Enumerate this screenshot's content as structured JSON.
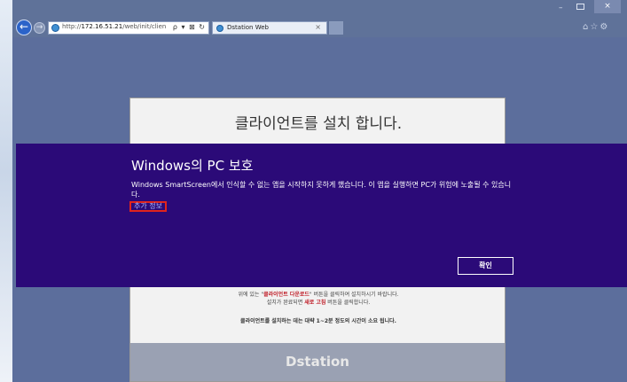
{
  "browser": {
    "url_prefix": "http://",
    "url_host": "172.16.51.21",
    "url_path": "/web/init/clien",
    "address_icons": "ρ ▾ ⊠ ↻",
    "tab_title": "Dstation Web",
    "tab_close": "×",
    "back_glyph": "←",
    "forward_glyph": "→",
    "window_min": "–",
    "window_close": "×",
    "toolbar_icons": "⌂☆⚙"
  },
  "setup_page": {
    "title": "클라이언트를 설치 합니다.",
    "instruction_prefix": "위에 있는 \"",
    "instruction_download": "클라이언트 다운로드",
    "instruction_suffix": "\" 버튼을 클릭하여 설치하시기 바랍니다.",
    "instruction2_prefix": "설치가 완료되면 ",
    "instruction2_refresh": "새로 고침",
    "instruction2_suffix": " 버튼을 클릭합니다.",
    "install_time_note": "클라이언트를 설치하는 데는 대략 1~2분 정도의 시간이 소요 됩니다.",
    "brand": "Dstation"
  },
  "smartscreen": {
    "title": "Windows의 PC 보호",
    "message": "Windows SmartScreen에서 인식할 수 없는 앱을 시작하지 못하게 했습니다. 이 앱을 실행하면 PC가 위험에 노출될 수 있습니다.",
    "more_info": "추가 정보",
    "ok_button": "확인"
  },
  "colors": {
    "smartscreen_bg": "#2b0a78",
    "highlight_box": "#e0241c",
    "page_bg": "#5c6e9c"
  }
}
